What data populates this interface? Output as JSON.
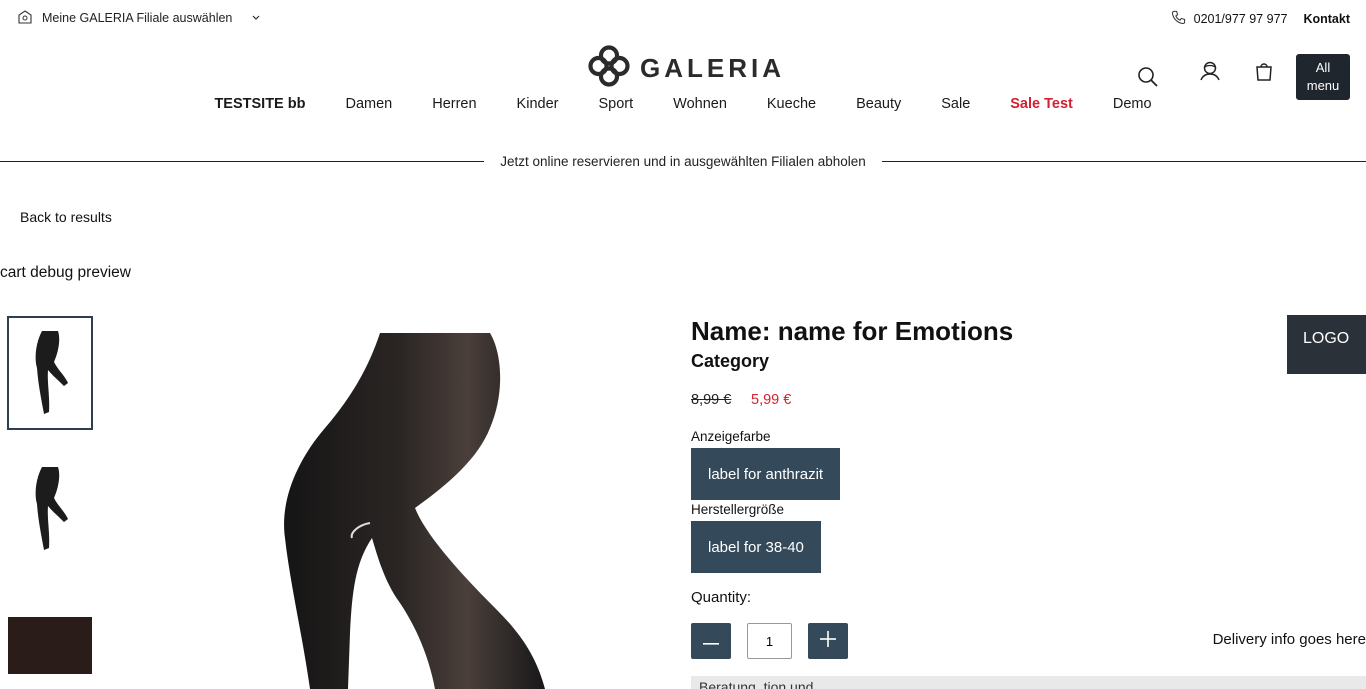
{
  "topbar": {
    "store_label": "Meine GALERIA Filiale auswählen",
    "phone": "0201/977 97 977",
    "contact_label": "Kontakt"
  },
  "logo": {
    "wordmark": "GALERIA"
  },
  "header": {
    "all_menu_label_1": "All",
    "all_menu_label_2": "menu"
  },
  "nav": {
    "items": [
      "TESTSITE bb",
      "Damen",
      "Herren",
      "Kinder",
      "Sport",
      "Wohnen",
      "Kueche",
      "Beauty",
      "Sale",
      "Sale Test",
      "Demo"
    ]
  },
  "banner": {
    "text": "Jetzt online reservieren und in ausgewählten Filialen abholen"
  },
  "back_link": "Back to results",
  "debug_title": "cart debug preview",
  "product": {
    "name": "Name: name for Emotions",
    "category": "Category",
    "price_old": "8,99 €",
    "price_new": "5,99 €",
    "color_label": "Anzeigefarbe",
    "color_value": "label for anthrazit",
    "size_label": "Herstellergröße",
    "size_value": "label for 38-40",
    "quantity_label": "Quantity:",
    "quantity_value": "1",
    "delivery_info": "Delivery info goes here",
    "bottom_bar_text": "Beratung, tion und"
  },
  "logo_box": "LOGO",
  "colors": {
    "accent_dark": "#34495a",
    "sale_red": "#d4202f",
    "menu_dark": "#1f262d"
  },
  "icons": [
    "store-icon",
    "chevron-down-icon",
    "phone-icon",
    "galeria-logo-icon",
    "search-icon",
    "account-icon",
    "cart-icon",
    "minus-icon",
    "plus-icon"
  ]
}
